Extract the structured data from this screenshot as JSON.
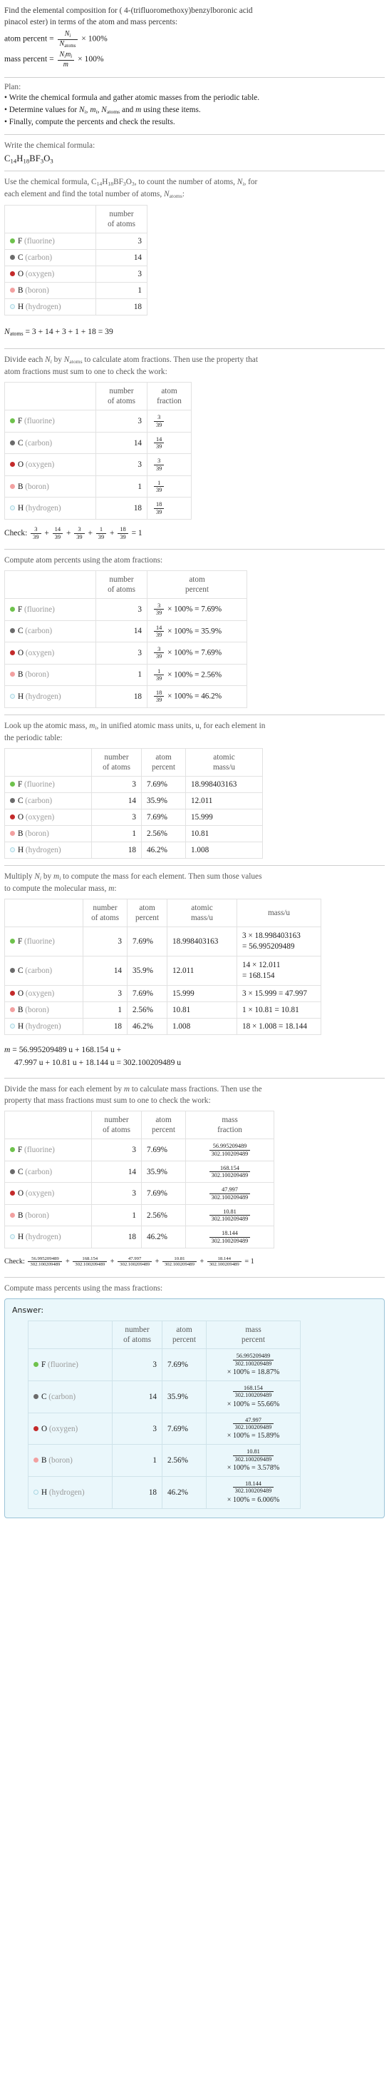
{
  "problem": {
    "question_part1": "Find the elemental composition for ( 4-(trifluoromethoxy)benzylboronic acid",
    "question_part2": "pinacol ester) in terms of the atom and mass percents:",
    "atom_percent_label": "atom percent =",
    "mass_percent_label": "mass percent =",
    "times100": "× 100%"
  },
  "plan": {
    "heading": "Plan:",
    "items": [
      "Write the chemical formula and gather atomic masses from the periodic table.",
      "Determine values for Nᵢ, mᵢ, N_atoms and m using these items.",
      "Finally, compute the percents and check the results."
    ]
  },
  "formula_section": {
    "heading": "Write the chemical formula:",
    "formula_plain": "C14H18BF3O3"
  },
  "count_section": {
    "text_part1": "Use the chemical formula,",
    "text_part2": ", to count the number of atoms,",
    "text_part3": ", for",
    "text_part4": "each element and find the total number of atoms,",
    "text_part5": ":",
    "total_line": "N_atoms = 3 + 14 + 3 + 1 + 18 = 39",
    "total_rhs": "= 3 + 14 + 3 + 1 + 18 = 39"
  },
  "fraction_section": {
    "text_part1": "Divide each",
    "text_part2": "by",
    "text_part3": "to calculate atom fractions. Then use the property that",
    "text_part4": "atom fractions must sum to one to check the work:",
    "check_label": "Check:",
    "check_result": "= 1"
  },
  "atom_percent_section": {
    "heading": "Compute atom percents using the atom fractions:"
  },
  "atomic_mass_section": {
    "text_part1": "Look up the atomic mass,",
    "text_part2": ", in unified atomic mass units, u, for each element in",
    "text_part3": "the periodic table:"
  },
  "mass_section": {
    "text_part1": "Multiply",
    "text_part2": "by",
    "text_part3": "to compute the mass for each element. Then sum those values",
    "text_part4": "to compute the molecular mass,",
    "text_part5": ":",
    "sum_line1": "= 56.995209489 u + 168.154 u +",
    "sum_line2": "47.997 u + 10.81 u + 18.144 u = 302.100209489 u"
  },
  "mass_fraction_section": {
    "text_part1": "Divide the mass for each element by",
    "text_part2": "to calculate mass fractions. Then use the",
    "text_part3": "property that mass fractions must sum to one to check the work:",
    "check_label": "Check:",
    "check_result": "= 1"
  },
  "mass_percent_section": {
    "heading": "Compute mass percents using the mass fractions:",
    "answer_label": "Answer:"
  },
  "columns": {
    "blank": "",
    "number_of_atoms": [
      "number",
      "of atoms"
    ],
    "atom_fraction": [
      "atom",
      "fraction"
    ],
    "atom_percent": [
      "atom",
      "percent"
    ],
    "atomic_mass": [
      "atomic",
      "mass/u"
    ],
    "mass": [
      "mass/u"
    ],
    "mass_fraction": [
      "mass",
      "fraction"
    ],
    "mass_percent": [
      "mass",
      "percent"
    ]
  },
  "total_atoms": 39,
  "molecular_mass": "302.100209489",
  "elements": [
    {
      "symbol": "F",
      "name": "(fluorine)",
      "color": "#6ec24c",
      "hollow": false,
      "count": "3",
      "fraction_num": "3",
      "fraction_den": "39",
      "atom_percent": "7.69%",
      "atomic_mass": "18.998403163",
      "mass_expr": "3 × 18.998403163",
      "mass_result": "= 56.995209489",
      "mass_value": "56.995209489",
      "mass_percent": "18.87%"
    },
    {
      "symbol": "C",
      "name": "(carbon)",
      "color": "#6b6b6b",
      "hollow": false,
      "count": "14",
      "fraction_num": "14",
      "fraction_den": "39",
      "atom_percent": "35.9%",
      "atomic_mass": "12.011",
      "mass_expr": "14 × 12.011",
      "mass_result": "= 168.154",
      "mass_value": "168.154",
      "mass_percent": "55.66%"
    },
    {
      "symbol": "O",
      "name": "(oxygen)",
      "color": "#c32a2a",
      "hollow": false,
      "count": "3",
      "fraction_num": "3",
      "fraction_den": "39",
      "atom_percent": "7.69%",
      "atomic_mass": "15.999",
      "mass_expr": "3 × 15.999 = 47.997",
      "mass_result": "",
      "mass_value": "47.997",
      "mass_percent": "15.89%"
    },
    {
      "symbol": "B",
      "name": "(boron)",
      "color": "#f2a0a0",
      "hollow": false,
      "count": "1",
      "fraction_num": "1",
      "fraction_den": "39",
      "atom_percent": "2.56%",
      "atomic_mass": "10.81",
      "mass_expr": "1 × 10.81 = 10.81",
      "mass_result": "",
      "mass_value": "10.81",
      "mass_percent": "3.578%"
    },
    {
      "symbol": "H",
      "name": "(hydrogen)",
      "color": "#dff2f7",
      "hollow": true,
      "count": "18",
      "fraction_num": "18",
      "fraction_den": "39",
      "atom_percent": "46.2%",
      "atomic_mass": "1.008",
      "mass_expr": "18 × 1.008 = 18.144",
      "mass_result": "",
      "mass_value": "18.144",
      "mass_percent": "6.006%"
    }
  ],
  "symbols": {
    "Ni": "N",
    "Ni_sub": "i",
    "Natoms": "N",
    "Natoms_sub": "atoms",
    "mi": "m",
    "mi_sub": "i",
    "m": "m",
    "times100pct": "× 100%",
    "equals": "=",
    "plus": "+",
    "times": "×"
  }
}
